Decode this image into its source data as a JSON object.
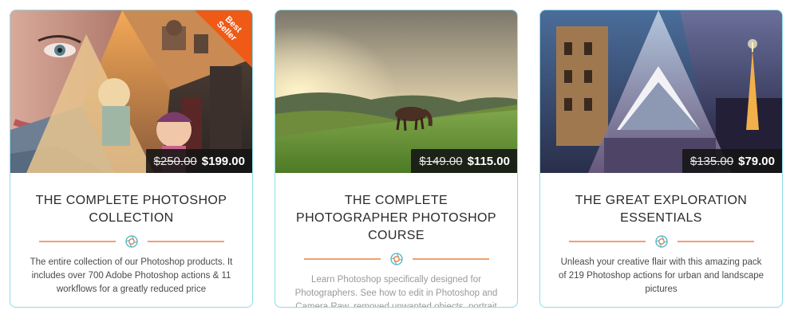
{
  "cards": [
    {
      "title": "THE COMPLETE PHOTOSHOP COLLECTION",
      "badge": "Best Seller",
      "old_price": "$250.00",
      "new_price": "$199.00",
      "description": "The entire collection of our Photoshop products. It includes over 700 Adobe Photoshop actions & 11 workflows for a greatly reduced price"
    },
    {
      "title": "THE COMPLETE PHOTOGRAPHER PHOTOSHOP COURSE",
      "old_price": "$149.00",
      "new_price": "$115.00",
      "description": "Learn Photoshop specifically designed for Photographers. See how to edit in Photoshop and Camera Raw, removed unwanted objects, portrait retouching and much more!"
    },
    {
      "title": "THE GREAT EXPLORATION ESSENTIALS",
      "old_price": "$135.00",
      "new_price": "$79.00",
      "description": "Unleash your creative flair with this amazing pack of 219 Photoshop actions for urban and landscape pictures"
    }
  ],
  "colors": {
    "card_border": "#8fe0ea",
    "badge": "#ef5a16",
    "divider": "#f0a070",
    "price_bg": "#141414"
  },
  "icons": {
    "divider": "camera-lens-icon",
    "badge": "best-seller-ribbon"
  }
}
